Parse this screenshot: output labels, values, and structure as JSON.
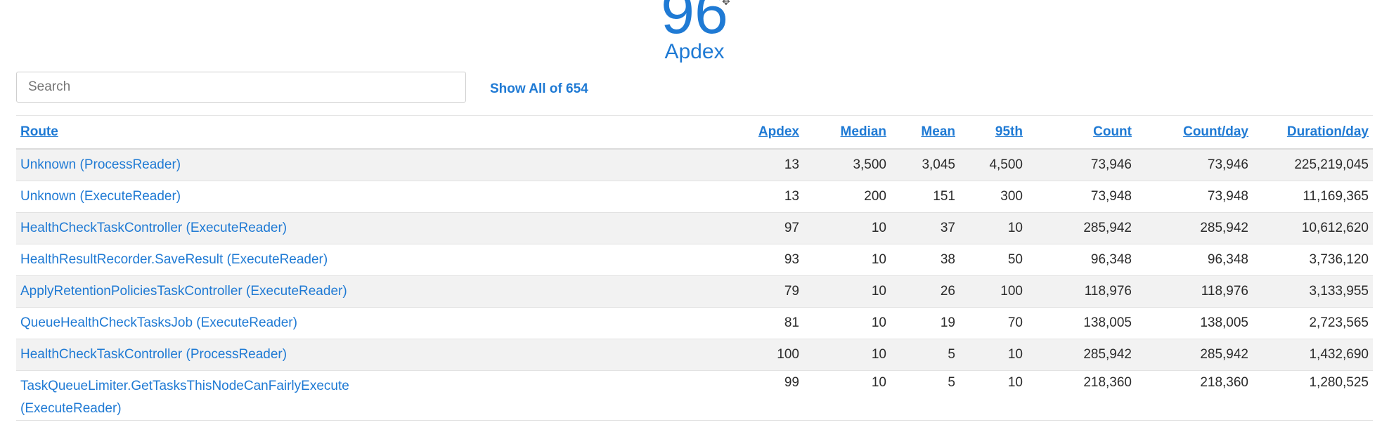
{
  "summary": {
    "apdex_value": "96",
    "apdex_label": "Apdex"
  },
  "search": {
    "placeholder": "Search"
  },
  "show_all_label": "Show All of 654",
  "table": {
    "columns": [
      "Route",
      "Apdex",
      "Median",
      "Mean",
      "95th",
      "Count",
      "Count/day",
      "Duration/day"
    ],
    "rows": [
      [
        "Unknown (ProcessReader)",
        "13",
        "3,500",
        "3,045",
        "4,500",
        "73,946",
        "73,946",
        "225,219,045"
      ],
      [
        "Unknown (ExecuteReader)",
        "13",
        "200",
        "151",
        "300",
        "73,948",
        "73,948",
        "11,169,365"
      ],
      [
        "HealthCheckTaskController (ExecuteReader)",
        "97",
        "10",
        "37",
        "10",
        "285,942",
        "285,942",
        "10,612,620"
      ],
      [
        "HealthResultRecorder.SaveResult (ExecuteReader)",
        "93",
        "10",
        "38",
        "50",
        "96,348",
        "96,348",
        "3,736,120"
      ],
      [
        "ApplyRetentionPoliciesTaskController (ExecuteReader)",
        "79",
        "10",
        "26",
        "100",
        "118,976",
        "118,976",
        "3,133,955"
      ],
      [
        "QueueHealthCheckTasksJob (ExecuteReader)",
        "81",
        "10",
        "19",
        "70",
        "138,005",
        "138,005",
        "2,723,565"
      ],
      [
        "HealthCheckTaskController (ProcessReader)",
        "100",
        "10",
        "5",
        "10",
        "285,942",
        "285,942",
        "1,432,690"
      ],
      [
        "TaskQueueLimiter.GetTasksThisNodeCanFairlyExecute (ExecuteReader)",
        "99",
        "10",
        "5",
        "10",
        "218,360",
        "218,360",
        "1,280,525"
      ]
    ]
  },
  "colors": {
    "accent": "#1f7ad4",
    "row_stripe": "#f2f2f2"
  }
}
